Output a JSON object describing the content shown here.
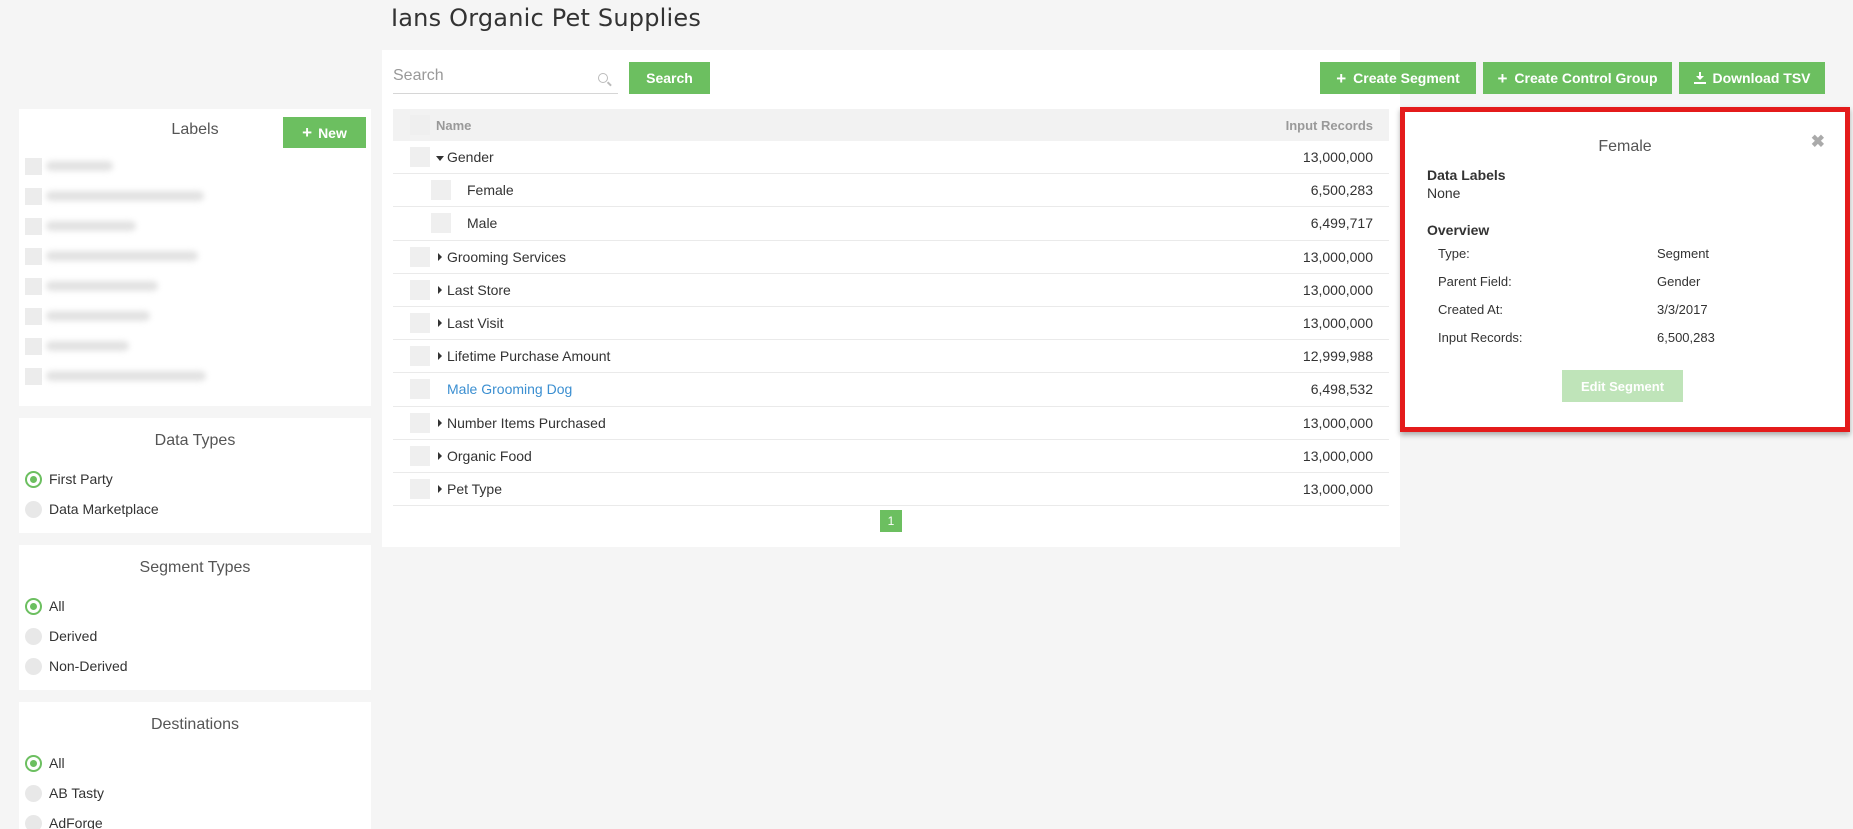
{
  "page": {
    "title": "Ians Organic Pet Supplies"
  },
  "labels": {
    "title": "Labels",
    "new_label": "New",
    "items_blurred": 8
  },
  "data_types": {
    "title": "Data Types",
    "options": [
      {
        "label": "First Party",
        "selected": true
      },
      {
        "label": "Data Marketplace",
        "selected": false
      }
    ]
  },
  "segment_types": {
    "title": "Segment Types",
    "options": [
      {
        "label": "All",
        "selected": true
      },
      {
        "label": "Derived",
        "selected": false
      },
      {
        "label": "Non-Derived",
        "selected": false
      }
    ]
  },
  "destinations": {
    "title": "Destinations",
    "options": [
      {
        "label": "All",
        "selected": true
      },
      {
        "label": "AB Tasty",
        "selected": false
      },
      {
        "label": "AdForge",
        "selected": false
      }
    ]
  },
  "toolbar": {
    "search_placeholder": "Search",
    "search_label": "Search",
    "create_segment_label": "Create Segment",
    "create_control_group_label": "Create Control Group",
    "download_tsv_label": "Download TSV"
  },
  "table": {
    "headers": {
      "name": "Name",
      "records": "Input Records"
    },
    "rows": [
      {
        "name": "Gender",
        "records": "13,000,000",
        "caret": "down",
        "child": false,
        "link": false
      },
      {
        "name": "Female",
        "records": "6,500,283",
        "caret": "none",
        "child": true,
        "link": false
      },
      {
        "name": "Male",
        "records": "6,499,717",
        "caret": "none",
        "child": true,
        "link": false
      },
      {
        "name": "Grooming Services",
        "records": "13,000,000",
        "caret": "right",
        "child": false,
        "link": false
      },
      {
        "name": "Last Store",
        "records": "13,000,000",
        "caret": "right",
        "child": false,
        "link": false
      },
      {
        "name": "Last Visit",
        "records": "13,000,000",
        "caret": "right",
        "child": false,
        "link": false
      },
      {
        "name": "Lifetime Purchase Amount",
        "records": "12,999,988",
        "caret": "right",
        "child": false,
        "link": false
      },
      {
        "name": "Male Grooming Dog",
        "records": "6,498,532",
        "caret": "none",
        "child": false,
        "link": true
      },
      {
        "name": "Number Items Purchased",
        "records": "13,000,000",
        "caret": "right",
        "child": false,
        "link": false
      },
      {
        "name": "Organic Food",
        "records": "13,000,000",
        "caret": "right",
        "child": false,
        "link": false
      },
      {
        "name": "Pet Type",
        "records": "13,000,000",
        "caret": "right",
        "child": false,
        "link": false
      }
    ],
    "page_number": "1"
  },
  "detail": {
    "title": "Female",
    "close_glyph": "✖",
    "data_labels_heading": "Data Labels",
    "data_labels_value": "None",
    "overview_heading": "Overview",
    "overview": [
      {
        "key": "Type:",
        "value": "Segment"
      },
      {
        "key": "Parent Field:",
        "value": "Gender"
      },
      {
        "key": "Created At:",
        "value": "3/3/2017"
      },
      {
        "key": "Input Records:",
        "value": "6,500,283"
      }
    ],
    "edit_label": "Edit Segment"
  },
  "colors": {
    "accent": "#6cbf60",
    "link": "#3b8fd1",
    "highlight": "#e41b1b"
  }
}
